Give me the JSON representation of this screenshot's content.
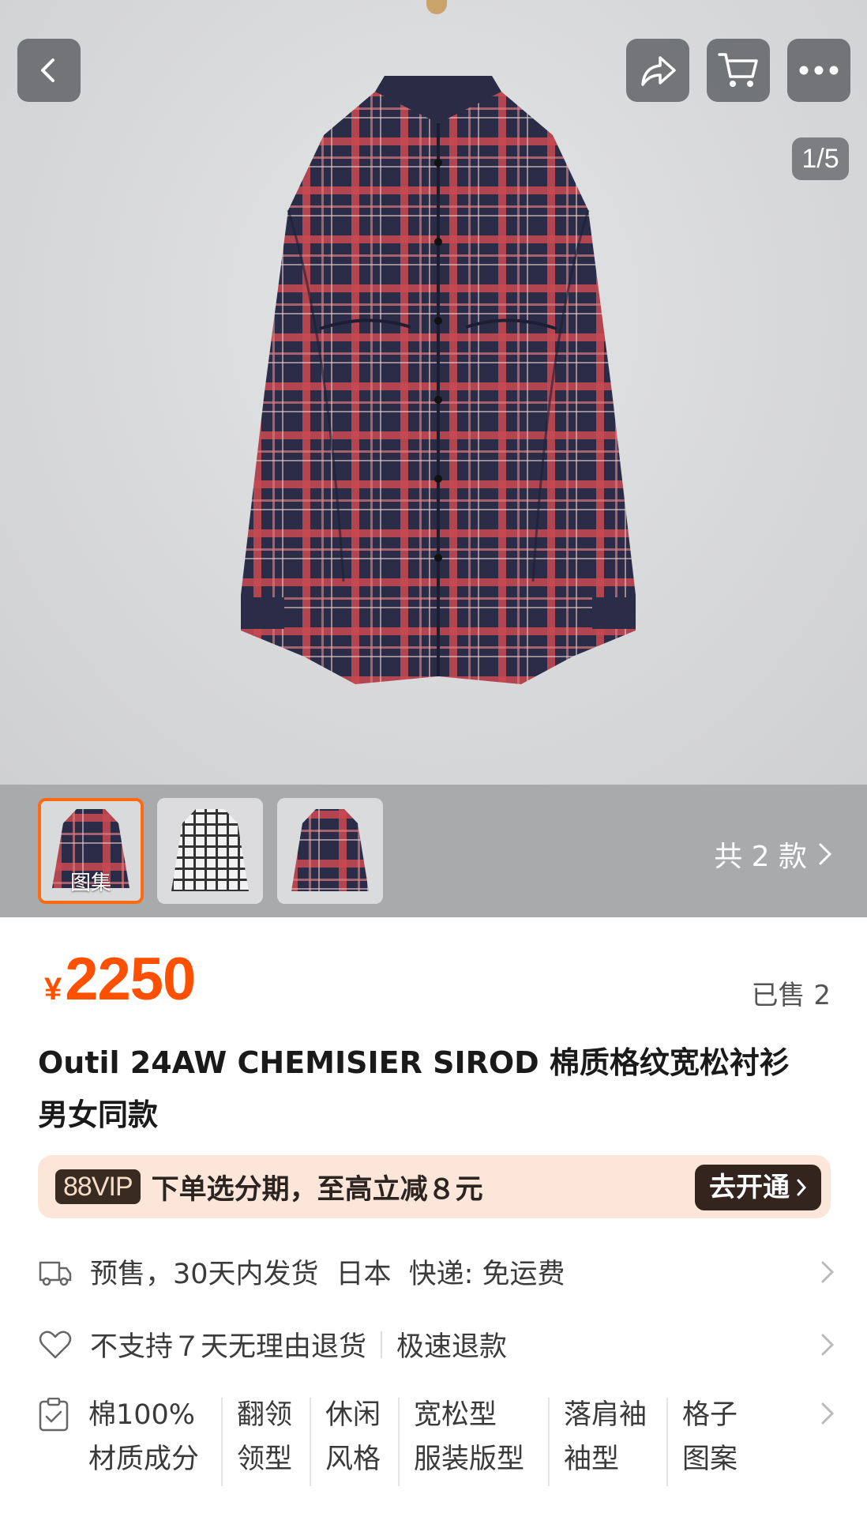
{
  "gallery": {
    "counter": "1/5",
    "variants_label": "共 2 款",
    "thumbs": [
      {
        "label": "图集",
        "colorway": "red-navy-plaid"
      },
      {
        "label": "",
        "colorway": "white-black-plaid"
      },
      {
        "label": "",
        "colorway": "red-navy-plaid"
      }
    ]
  },
  "toolbar": {
    "icons": [
      "back-icon",
      "share-icon",
      "cart-icon",
      "more-icon"
    ]
  },
  "product": {
    "currency": "¥",
    "price": "2250",
    "sold": "已售 2",
    "title_line1": "Outil 24AW CHEMISIER SIROD 棉质格纹宽松衬衫",
    "title_line2": "男女同款"
  },
  "vip": {
    "badge": "88VIP",
    "text": "下单选分期，至高立减８元",
    "button": "去开通"
  },
  "shipping": {
    "presale": "预售，30天内发货",
    "origin": "日本",
    "delivery": "快递: 免运费"
  },
  "returns": {
    "policy": "不支持７天无理由退货",
    "refund": "极速退款"
  },
  "attributes": [
    {
      "value": "棉100%",
      "key": "材质成分"
    },
    {
      "value": "翻领",
      "key": "领型"
    },
    {
      "value": "休闲",
      "key": "风格"
    },
    {
      "value": "宽松型",
      "key": "服装版型"
    },
    {
      "value": "落肩袖",
      "key": "袖型"
    },
    {
      "value": "格子",
      "key": "图案"
    }
  ],
  "colors": {
    "accent": "#ff5000",
    "vip_bg": "#fbe6d9",
    "vip_dark": "#33251d",
    "plaid_base": "#2b2d48",
    "plaid_red": "#c94a52"
  }
}
